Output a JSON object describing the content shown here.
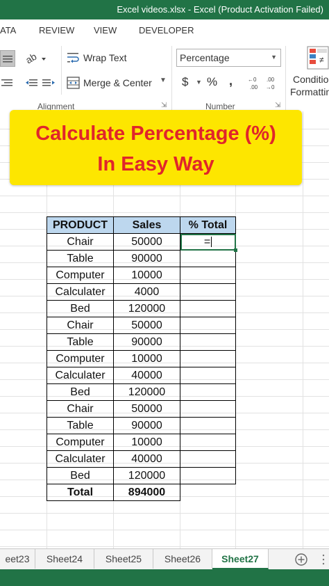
{
  "window": {
    "title": "Excel videos.xlsx -  Excel (Product Activation Failed)"
  },
  "ribbon_tabs": [
    "ATA",
    "REVIEW",
    "VIEW",
    "DEVELOPER"
  ],
  "ribbon": {
    "wrap_text": "Wrap Text",
    "merge_center": "Merge & Center",
    "alignment_group": "Alignment",
    "number_format": "Percentage",
    "currency": "$",
    "percent": "%",
    "comma": ",",
    "number_group": "Number",
    "conditional_line1": "Conditio",
    "conditional_line2": "Formattin"
  },
  "banner": {
    "line1": "Calculate Percentage (%)",
    "line2": "In Easy Way"
  },
  "table": {
    "headers": [
      "PRODUCT",
      "Sales",
      "% Total"
    ],
    "rows": [
      [
        "Chair",
        "50000"
      ],
      [
        "Table",
        "90000"
      ],
      [
        "Computer",
        "10000"
      ],
      [
        "Calculater",
        "4000"
      ],
      [
        "Bed",
        "120000"
      ],
      [
        "Chair",
        "50000"
      ],
      [
        "Table",
        "90000"
      ],
      [
        "Computer",
        "10000"
      ],
      [
        "Calculater",
        "40000"
      ],
      [
        "Bed",
        "120000"
      ],
      [
        "Chair",
        "50000"
      ],
      [
        "Table",
        "90000"
      ],
      [
        "Computer",
        "10000"
      ],
      [
        "Calculater",
        "40000"
      ],
      [
        "Bed",
        "120000"
      ]
    ],
    "total_label": "Total",
    "total_value": "894000",
    "editing_value": "="
  },
  "sheets": {
    "tabs": [
      "eet23",
      "Sheet24",
      "Sheet25",
      "Sheet26",
      "Sheet27"
    ],
    "active": "Sheet27"
  },
  "colors": {
    "excel_green": "#217346",
    "banner_yellow": "#fde600",
    "banner_text": "#e0252b",
    "header_fill": "#bdd7ee"
  }
}
